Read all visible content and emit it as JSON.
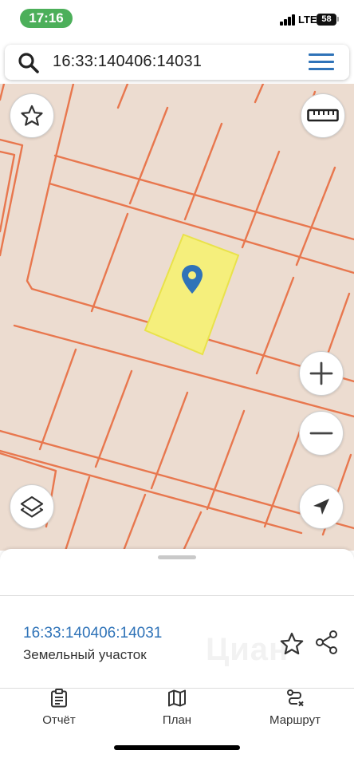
{
  "status_bar": {
    "time": "17:16",
    "network": "LTE",
    "battery": "58"
  },
  "search": {
    "query": "16:33:140406:14031",
    "search_icon": "search-icon",
    "menu_icon": "hamburger-menu-icon"
  },
  "map": {
    "favorite_icon": "star-outline-icon",
    "ruler_icon": "ruler-icon",
    "zoom_in_icon": "plus-icon",
    "zoom_out_icon": "minus-icon",
    "layers_icon": "layers-icon",
    "locate_icon": "navigation-arrow-icon",
    "marker_icon": "location-pin-icon",
    "colors": {
      "background": "#ecdcd0",
      "parcel_border": "#e8774e",
      "selected_parcel_fill": "#f5ef7c",
      "selected_parcel_border": "#e9e24a",
      "marker": "#2f73b8"
    }
  },
  "details": {
    "cadastral_number": "16:33:140406:14031",
    "object_type": "Земельный участок",
    "watermark": "Циан",
    "favorite_icon": "star-outline-icon",
    "share_icon": "share-icon"
  },
  "tabs": [
    {
      "label": "Отчёт",
      "icon": "clipboard-report-icon"
    },
    {
      "label": "План",
      "icon": "map-plan-icon"
    },
    {
      "label": "Маршрут",
      "icon": "route-icon"
    }
  ]
}
